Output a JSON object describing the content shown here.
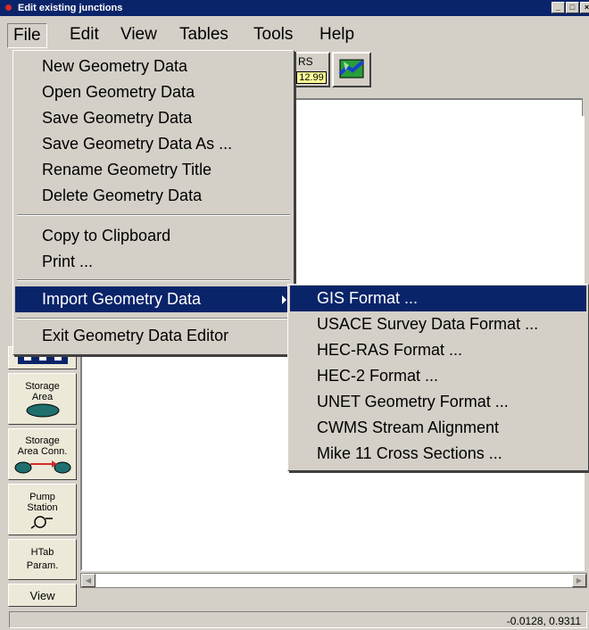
{
  "window": {
    "title": "Edit existing junctions",
    "controls": {
      "minimize": "_",
      "maximize": "□",
      "close": "×"
    }
  },
  "menubar": {
    "items": [
      {
        "label": "File"
      },
      {
        "label": "Edit"
      },
      {
        "label": "View"
      },
      {
        "label": "Tables"
      },
      {
        "label": "Tools"
      },
      {
        "label": "Help"
      }
    ]
  },
  "toolbar": {
    "rs_label": "RS",
    "rs_value": "12.99"
  },
  "file_menu": {
    "items": [
      {
        "label": "New Geometry Data"
      },
      {
        "label": "Open Geometry Data"
      },
      {
        "label": "Save Geometry Data"
      },
      {
        "label": "Save Geometry Data As ..."
      },
      {
        "label": "Rename Geometry Title"
      },
      {
        "label": "Delete Geometry Data"
      },
      {
        "label": "Copy to Clipboard"
      },
      {
        "label": "Print ..."
      },
      {
        "label": "Import Geometry Data"
      },
      {
        "label": "Exit Geometry Data Editor"
      }
    ]
  },
  "import_submenu": {
    "items": [
      {
        "label": "GIS Format ..."
      },
      {
        "label": "USACE Survey Data Format ..."
      },
      {
        "label": "HEC-RAS Format ..."
      },
      {
        "label": "HEC-2 Format ..."
      },
      {
        "label": "UNET Geometry Format ..."
      },
      {
        "label": "CWMS Stream Alignment"
      },
      {
        "label": "Mike 11 Cross Sections ..."
      }
    ]
  },
  "palette": {
    "storage_area": [
      "Storage",
      "Area"
    ],
    "storage_area_conn": [
      "Storage",
      "Area Conn."
    ],
    "pump_station": [
      "Pump",
      "Station"
    ],
    "htab_param": [
      "HTab",
      "Param."
    ],
    "view": "View"
  },
  "statusbar": {
    "coords": "-0.0128, 0.9311"
  },
  "colors": {
    "title_bar": "#0a246a",
    "highlight": "#0a246a",
    "face": "#d4d0c8",
    "rs_value_bg": "#ffff99"
  }
}
